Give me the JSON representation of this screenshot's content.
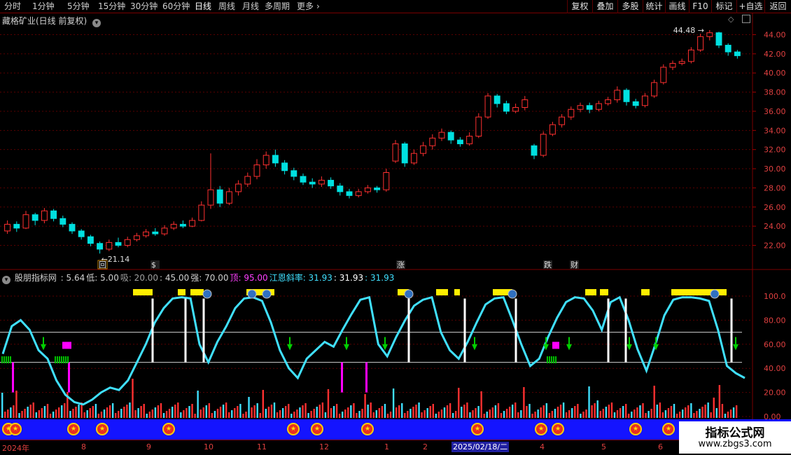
{
  "toolbar": {
    "periods": [
      "分时",
      "1分钟",
      "5分钟",
      "15分钟",
      "30分钟",
      "60分钟",
      "日线",
      "周线",
      "月线",
      "多周期",
      "更多"
    ],
    "active_period": "日线",
    "actions": [
      "复权",
      "叠加",
      "多股",
      "统计",
      "画线",
      "F10",
      "标记",
      "+自选",
      "返回"
    ]
  },
  "main_chart": {
    "title": "藏格矿业(日线 前复权)",
    "price_axis": [
      "44.00",
      "42.00",
      "40.00",
      "38.00",
      "36.00",
      "34.00",
      "32.00",
      "30.00",
      "28.00",
      "26.00",
      "24.00",
      "22.00"
    ],
    "high_label": "44.48",
    "low_label": "21.14",
    "event_markers": [
      {
        "label": "回",
        "color": "#ffffff"
      },
      {
        "label": "$",
        "color": "#ff3030"
      },
      {
        "label": "涨",
        "color": "#ffffff"
      },
      {
        "label": "跌",
        "color": "#ffffff"
      },
      {
        "label": "财",
        "color": "#ffffff"
      }
    ]
  },
  "indicator": {
    "name": "股朋指标网",
    "values": [
      {
        "label": "",
        "value": "5.64",
        "color": "#d0d0d0"
      },
      {
        "label": "低",
        "value": "5.00",
        "color": "#d0d0d0"
      },
      {
        "label": "吸",
        "value": "20.00",
        "color": "#a0a0a0"
      },
      {
        "label": "",
        "value": "45.00",
        "color": "#d0d0d0"
      },
      {
        "label": "强",
        "value": "70.00",
        "color": "#d0d0d0"
      },
      {
        "label": "顶",
        "value": "95.00",
        "color": "#ff40ff"
      },
      {
        "label": "江恩斜率",
        "value": "31.93",
        "color": "#40e0ff"
      },
      {
        "label": "",
        "value": "31.93",
        "color": "#ffffff"
      },
      {
        "label": "",
        "value": "31.93",
        "color": "#40e0ff"
      }
    ],
    "axis": [
      "100.0",
      "80.00",
      "60.00",
      "40.00",
      "20.00",
      "0.00"
    ]
  },
  "chart_data": {
    "type": "candlestick",
    "title": "藏格矿业(日线 前复权)",
    "ylim": [
      20.5,
      45.5
    ],
    "candles": [
      {
        "o": 23.5,
        "c": 24.2,
        "h": 24.6,
        "l": 23.2
      },
      {
        "o": 24.2,
        "c": 23.8,
        "h": 24.5,
        "l": 23.4
      },
      {
        "o": 23.8,
        "c": 25.2,
        "h": 25.6,
        "l": 23.7
      },
      {
        "o": 25.2,
        "c": 24.6,
        "h": 25.4,
        "l": 24.1
      },
      {
        "o": 24.6,
        "c": 25.6,
        "h": 25.9,
        "l": 24.3
      },
      {
        "o": 25.6,
        "c": 24.8,
        "h": 25.8,
        "l": 24.5
      },
      {
        "o": 24.8,
        "c": 24.2,
        "h": 25.1,
        "l": 23.9
      },
      {
        "o": 24.2,
        "c": 23.5,
        "h": 24.4,
        "l": 23.2
      },
      {
        "o": 23.5,
        "c": 22.9,
        "h": 23.7,
        "l": 22.6
      },
      {
        "o": 22.9,
        "c": 22.2,
        "h": 23.1,
        "l": 21.9
      },
      {
        "o": 22.2,
        "c": 21.6,
        "h": 22.4,
        "l": 21.14
      },
      {
        "o": 21.6,
        "c": 22.3,
        "h": 22.6,
        "l": 21.4
      },
      {
        "o": 22.3,
        "c": 22.0,
        "h": 22.8,
        "l": 21.8
      },
      {
        "o": 22.0,
        "c": 22.6,
        "h": 22.9,
        "l": 21.8
      },
      {
        "o": 22.6,
        "c": 23.0,
        "h": 23.3,
        "l": 22.4
      },
      {
        "o": 23.0,
        "c": 23.4,
        "h": 23.7,
        "l": 22.8
      },
      {
        "o": 23.4,
        "c": 23.2,
        "h": 23.8,
        "l": 23.0
      },
      {
        "o": 23.2,
        "c": 23.8,
        "h": 24.1,
        "l": 23.0
      },
      {
        "o": 23.8,
        "c": 24.2,
        "h": 24.5,
        "l": 23.6
      },
      {
        "o": 24.2,
        "c": 24.0,
        "h": 24.6,
        "l": 23.8
      },
      {
        "o": 24.0,
        "c": 24.6,
        "h": 24.9,
        "l": 23.9
      },
      {
        "o": 24.6,
        "c": 26.2,
        "h": 26.6,
        "l": 24.5
      },
      {
        "o": 26.2,
        "c": 27.8,
        "h": 31.6,
        "l": 25.8
      },
      {
        "o": 27.8,
        "c": 26.4,
        "h": 28.2,
        "l": 26.0
      },
      {
        "o": 26.4,
        "c": 27.6,
        "h": 28.0,
        "l": 26.2
      },
      {
        "o": 27.6,
        "c": 28.4,
        "h": 28.8,
        "l": 27.2
      },
      {
        "o": 28.4,
        "c": 29.2,
        "h": 29.6,
        "l": 28.1
      },
      {
        "o": 29.2,
        "c": 30.4,
        "h": 31.0,
        "l": 28.9
      },
      {
        "o": 30.4,
        "c": 31.4,
        "h": 31.8,
        "l": 30.0
      },
      {
        "o": 31.4,
        "c": 30.6,
        "h": 32.0,
        "l": 30.2
      },
      {
        "o": 30.6,
        "c": 29.8,
        "h": 30.9,
        "l": 29.4
      },
      {
        "o": 29.8,
        "c": 29.2,
        "h": 30.1,
        "l": 28.8
      },
      {
        "o": 29.2,
        "c": 28.6,
        "h": 29.5,
        "l": 28.3
      },
      {
        "o": 28.6,
        "c": 28.4,
        "h": 29.0,
        "l": 28.0
      },
      {
        "o": 28.4,
        "c": 28.8,
        "h": 29.2,
        "l": 28.1
      },
      {
        "o": 28.8,
        "c": 28.2,
        "h": 29.1,
        "l": 27.9
      },
      {
        "o": 28.2,
        "c": 27.6,
        "h": 28.5,
        "l": 27.2
      },
      {
        "o": 27.6,
        "c": 27.2,
        "h": 27.9,
        "l": 26.9
      },
      {
        "o": 27.2,
        "c": 27.6,
        "h": 27.9,
        "l": 27.0
      },
      {
        "o": 27.6,
        "c": 28.0,
        "h": 28.3,
        "l": 27.4
      },
      {
        "o": 28.0,
        "c": 27.8,
        "h": 28.2,
        "l": 27.5
      },
      {
        "o": 27.8,
        "c": 29.6,
        "h": 30.0,
        "l": 27.6
      },
      {
        "o": 30.8,
        "c": 32.6,
        "h": 33.0,
        "l": 30.6
      },
      {
        "o": 32.6,
        "c": 30.6,
        "h": 32.8,
        "l": 30.2
      },
      {
        "o": 30.6,
        "c": 31.6,
        "h": 32.0,
        "l": 30.4
      },
      {
        "o": 31.6,
        "c": 32.4,
        "h": 32.8,
        "l": 31.3
      },
      {
        "o": 32.4,
        "c": 33.2,
        "h": 33.6,
        "l": 32.0
      },
      {
        "o": 33.2,
        "c": 33.8,
        "h": 34.2,
        "l": 32.9
      },
      {
        "o": 33.8,
        "c": 33.0,
        "h": 34.0,
        "l": 32.6
      },
      {
        "o": 33.0,
        "c": 32.6,
        "h": 33.3,
        "l": 32.3
      },
      {
        "o": 32.6,
        "c": 33.4,
        "h": 33.8,
        "l": 32.4
      },
      {
        "o": 33.4,
        "c": 35.4,
        "h": 35.8,
        "l": 33.2
      },
      {
        "o": 35.4,
        "c": 37.6,
        "h": 37.9,
        "l": 35.2
      },
      {
        "o": 37.6,
        "c": 36.8,
        "h": 37.8,
        "l": 36.4
      },
      {
        "o": 36.8,
        "c": 36.0,
        "h": 37.1,
        "l": 35.7
      },
      {
        "o": 36.0,
        "c": 36.4,
        "h": 36.8,
        "l": 35.8
      },
      {
        "o": 36.4,
        "c": 37.2,
        "h": 37.6,
        "l": 36.1
      },
      {
        "o": 32.4,
        "c": 31.4,
        "h": 32.6,
        "l": 31.0
      },
      {
        "o": 31.4,
        "c": 33.6,
        "h": 33.9,
        "l": 31.2
      },
      {
        "o": 33.6,
        "c": 34.6,
        "h": 34.9,
        "l": 33.4
      },
      {
        "o": 34.6,
        "c": 35.4,
        "h": 35.7,
        "l": 34.3
      },
      {
        "o": 35.4,
        "c": 36.2,
        "h": 36.5,
        "l": 35.1
      },
      {
        "o": 36.2,
        "c": 36.6,
        "h": 36.9,
        "l": 35.9
      },
      {
        "o": 36.6,
        "c": 36.2,
        "h": 36.9,
        "l": 35.8
      },
      {
        "o": 36.2,
        "c": 36.8,
        "h": 37.1,
        "l": 36.0
      },
      {
        "o": 36.8,
        "c": 37.2,
        "h": 37.5,
        "l": 36.6
      },
      {
        "o": 37.2,
        "c": 38.2,
        "h": 38.6,
        "l": 36.9
      },
      {
        "o": 38.2,
        "c": 37.0,
        "h": 38.4,
        "l": 36.6
      },
      {
        "o": 37.0,
        "c": 36.6,
        "h": 37.3,
        "l": 36.3
      },
      {
        "o": 36.6,
        "c": 37.6,
        "h": 37.9,
        "l": 36.4
      },
      {
        "o": 37.6,
        "c": 39.0,
        "h": 39.3,
        "l": 37.4
      },
      {
        "o": 39.0,
        "c": 40.6,
        "h": 40.9,
        "l": 38.8
      },
      {
        "o": 40.6,
        "c": 41.0,
        "h": 41.3,
        "l": 40.3
      },
      {
        "o": 41.0,
        "c": 41.2,
        "h": 41.5,
        "l": 40.8
      },
      {
        "o": 41.2,
        "c": 42.4,
        "h": 42.7,
        "l": 41.0
      },
      {
        "o": 42.4,
        "c": 43.8,
        "h": 44.1,
        "l": 42.2
      },
      {
        "o": 43.8,
        "c": 44.2,
        "h": 44.48,
        "l": 43.4
      },
      {
        "o": 44.2,
        "c": 42.9,
        "h": 44.3,
        "l": 42.6
      },
      {
        "o": 42.9,
        "c": 42.2,
        "h": 43.1,
        "l": 41.8
      },
      {
        "o": 42.2,
        "c": 41.8,
        "h": 42.4,
        "l": 41.5
      }
    ],
    "indicator_ylim": [
      0,
      100
    ],
    "indicator_levels": [
      5,
      20,
      45,
      70,
      95
    ],
    "indicator_line": [
      52,
      75,
      80,
      72,
      55,
      48,
      30,
      18,
      12,
      10,
      14,
      20,
      24,
      22,
      30,
      45,
      60,
      78,
      90,
      98,
      99,
      98,
      60,
      45,
      62,
      75,
      90,
      98,
      99,
      96,
      78,
      55,
      40,
      32,
      48,
      55,
      62,
      58,
      72,
      85,
      97,
      99,
      60,
      50,
      66,
      80,
      92,
      97,
      99,
      70,
      55,
      48,
      62,
      78,
      93,
      98,
      99,
      80,
      60,
      42,
      48,
      66,
      82,
      95,
      99,
      98,
      88,
      72,
      95,
      99,
      80,
      56,
      38,
      60,
      84,
      97,
      99,
      99,
      98,
      96,
      72,
      42,
      36,
      32
    ]
  },
  "xaxis": {
    "labels": [
      "2024年",
      "8",
      "9",
      "10",
      "11",
      "12",
      "1",
      "2",
      "4",
      "5",
      "6"
    ],
    "cursor_date": "2025/02/18/二"
  },
  "watermark": {
    "title": "指标公式网",
    "url": "www.zbgs3.com"
  },
  "colors": {
    "up": "#ff3030",
    "down": "#00e0e0",
    "indicator_line": "#40e0ff",
    "top_bar": "#ffee00",
    "buy_arrow": "#00d000",
    "medal_strip": "#1414ff"
  },
  "medal_icon": "star-medal-icon"
}
